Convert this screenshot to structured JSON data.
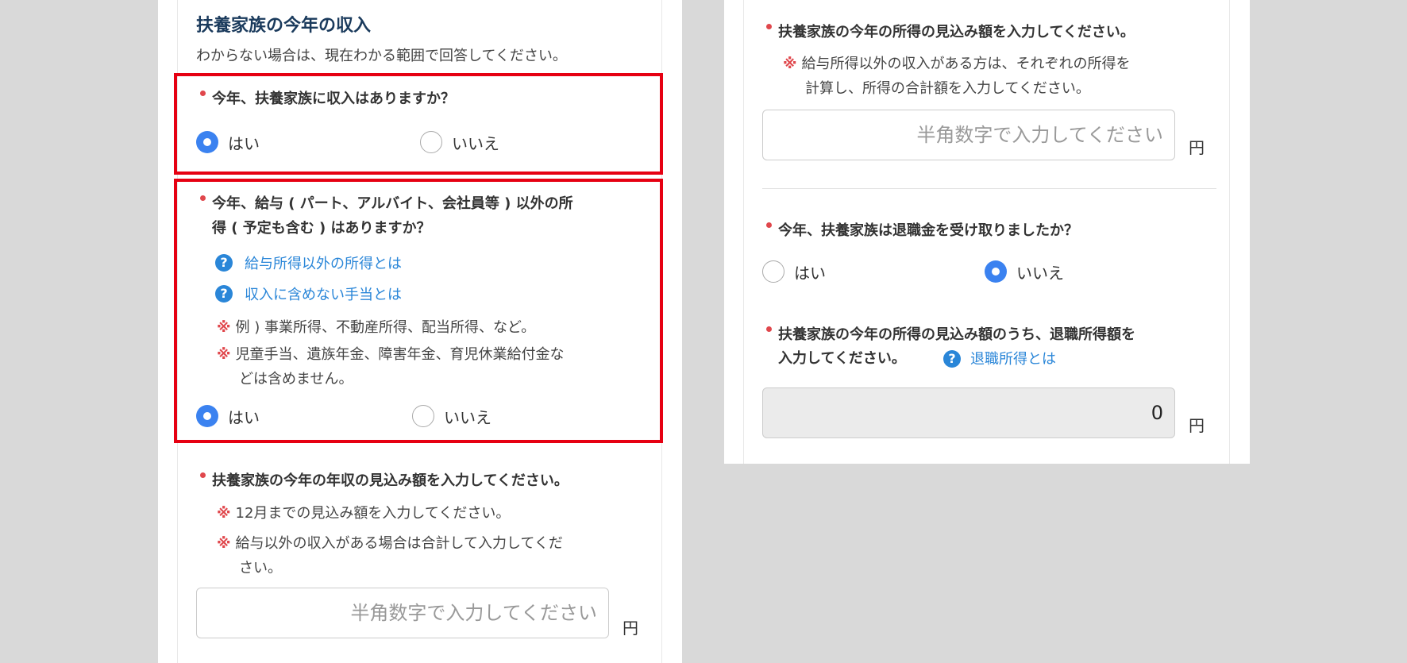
{
  "left": {
    "section_title": "扶養家族の今年の収入",
    "section_subtitle": "わからない場合は、現在わかる範囲で回答してください。",
    "q1": {
      "label": "今年、扶養家族に収入はありますか？",
      "yes_label": "はい",
      "no_label": "いいえ",
      "selected": "yes"
    },
    "q2": {
      "label_line1": "今年、給与 ( パート、アルバイト、会社員等 ) 以外の所",
      "label_line2": "得 ( 予定も含む ) はありますか？",
      "help_link_1": "給与所得以外の所得とは",
      "help_link_2": "収入に含めない手当とは",
      "note_mark": "※",
      "note_1": "例 ) 事業所得、不動産所得、配当所得、など。",
      "note_2_line1": "児童手当、遺族年金、障害年金、育児休業給付金な",
      "note_2_line2": "どは含めません。",
      "yes_label": "はい",
      "no_label": "いいえ",
      "selected": "yes"
    },
    "q3": {
      "label": "扶養家族の今年の年収の見込み額を入力してください。",
      "note_mark": "※",
      "note_1": "12月までの見込み額を入力してください。",
      "note_2_line1": "給与以外の収入がある場合は合計して入力してくだ",
      "note_2_line2": "さい。",
      "placeholder": "半角数字で入力してください",
      "unit": "円"
    }
  },
  "right": {
    "q4": {
      "label": "扶養家族の今年の所得の見込み額を入力してください。",
      "note_mark": "※",
      "note_line1": "給与所得以外の収入がある方は、それぞれの所得を",
      "note_line2": "計算し、所得の合計額を入力してください。",
      "placeholder": "半角数字で入力してください",
      "unit": "円"
    },
    "q5": {
      "label": "今年、扶養家族は退職金を受け取りましたか？",
      "yes_label": "はい",
      "no_label": "いいえ",
      "selected": "no"
    },
    "q6": {
      "label_line1": "扶養家族の今年の所得の見込み額のうち、退職所得額を",
      "label_line2": "入力してください。",
      "help_link": "退職所得とは",
      "value": "0",
      "unit": "円"
    }
  },
  "icons": {
    "help": "question-circle-icon",
    "required": "required-dot-icon"
  },
  "colors": {
    "highlight": "#e60012",
    "link": "#2a86d8",
    "radio_selected": "#3b82f0",
    "required": "#e0474c"
  }
}
